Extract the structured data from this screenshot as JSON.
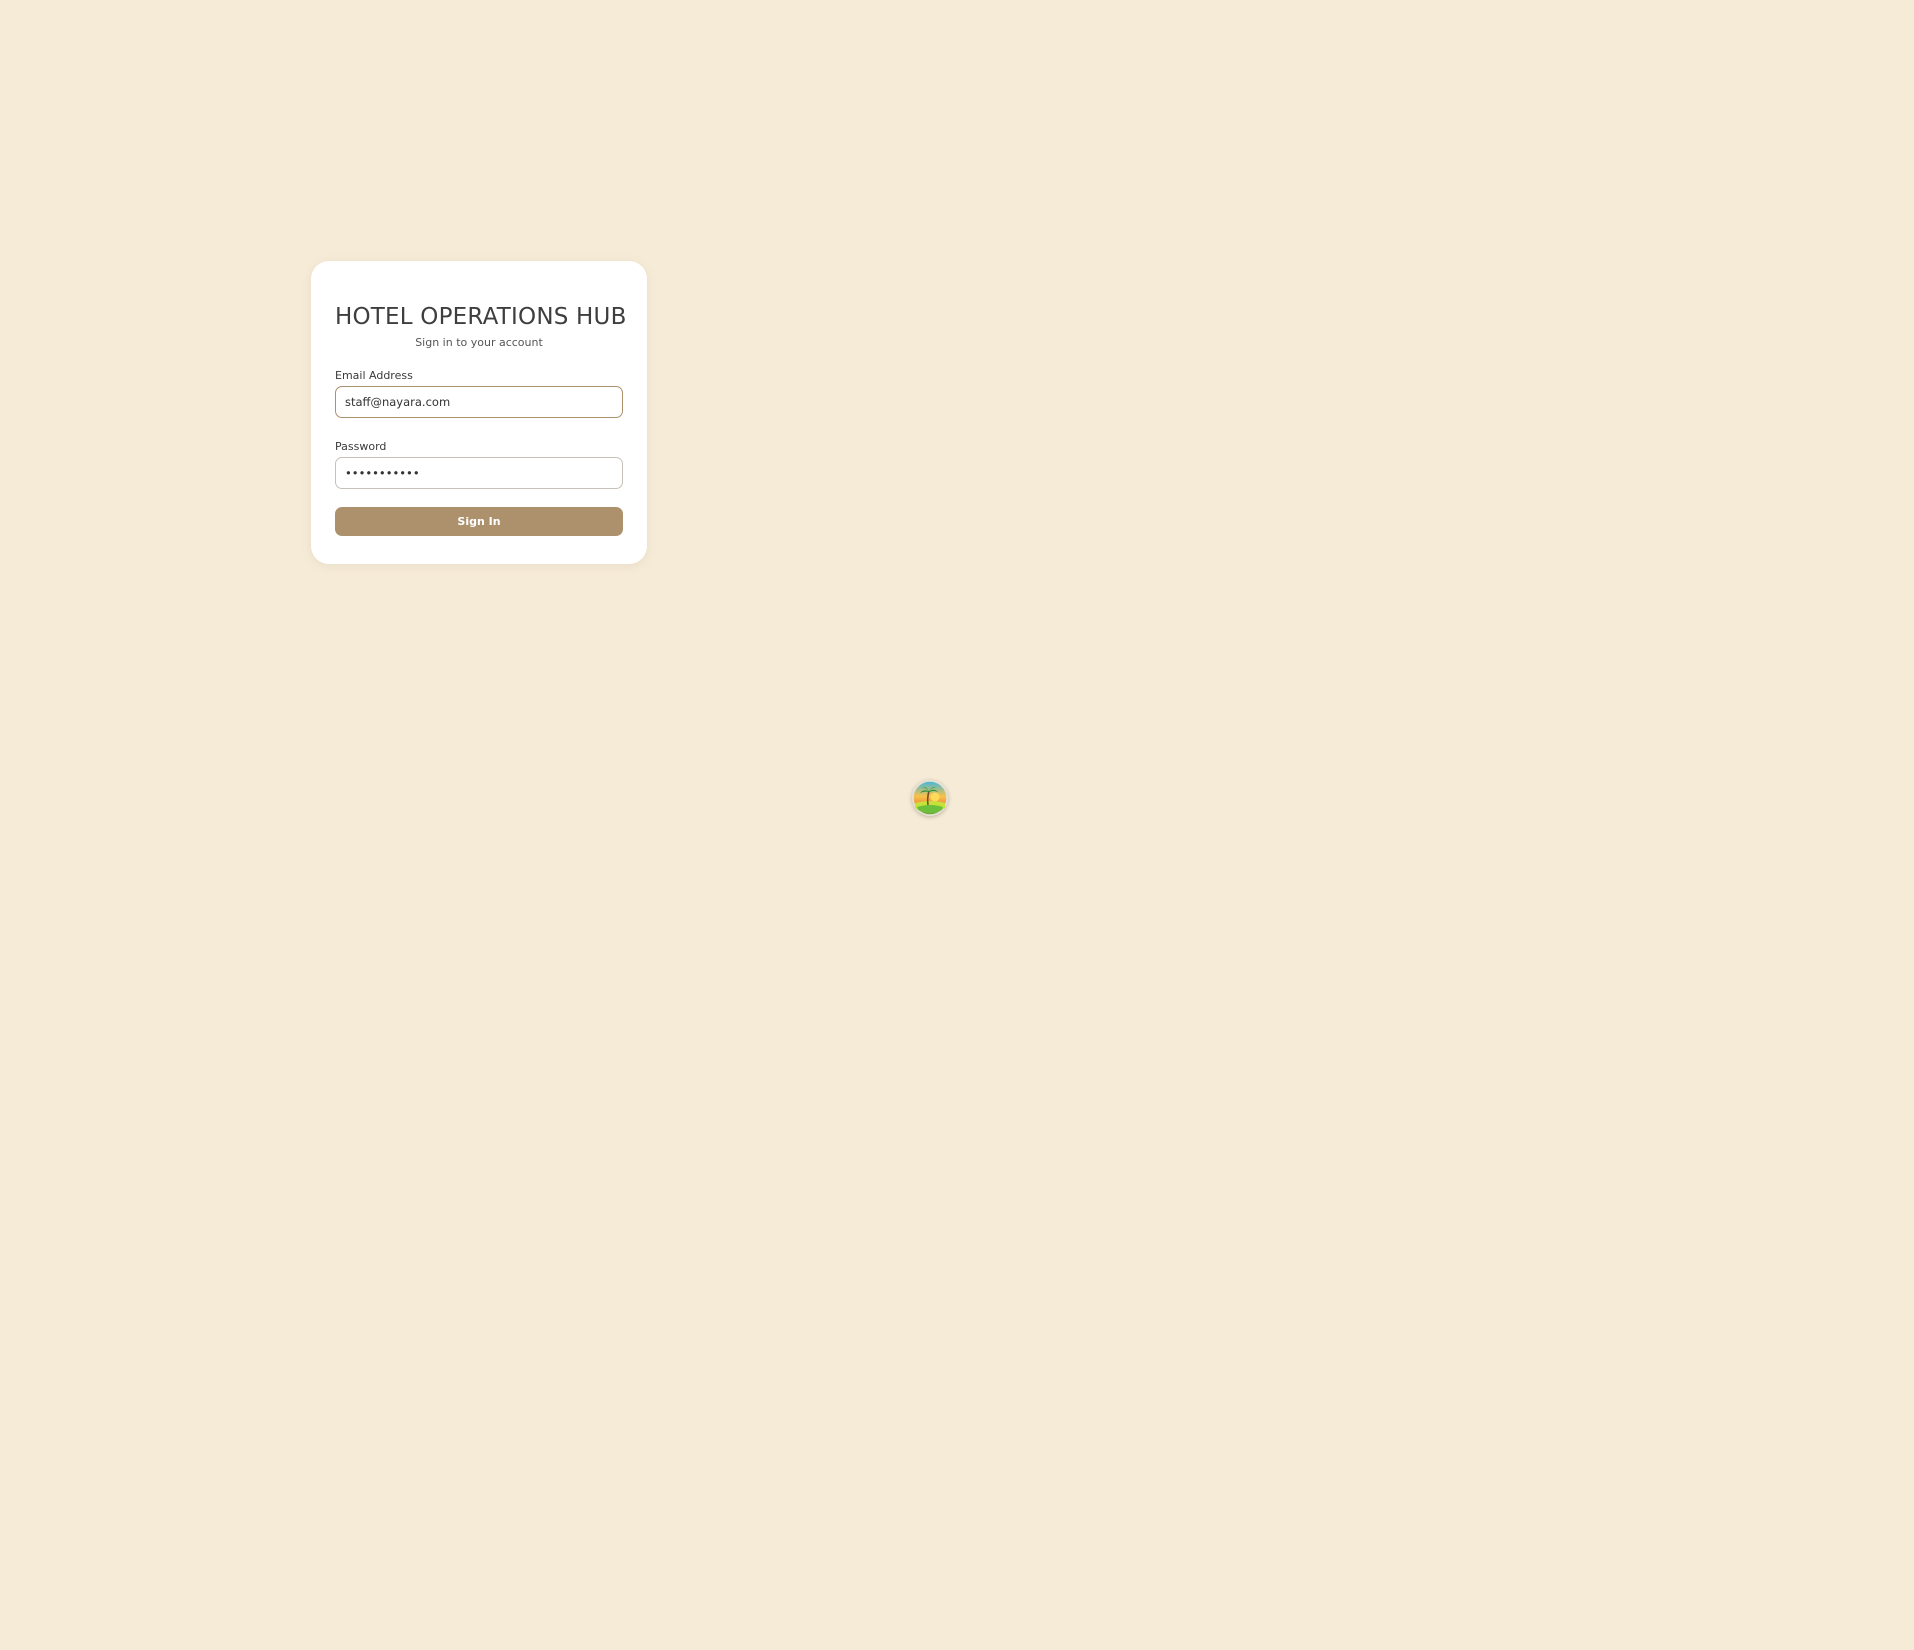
{
  "login": {
    "title": "HOTEL OPERATIONS HUB",
    "subtitle": "Sign in to your account",
    "email_label": "Email Address",
    "email_value": "staff@nayara.com",
    "password_label": "Password",
    "password_value": "•••••••••••",
    "submit_label": "Sign In"
  },
  "floating_badge": {
    "icon": "palm-beach-sunset-icon"
  },
  "colors": {
    "background": "#f5ebd7",
    "card": "#ffffff",
    "accent": "#ad916d",
    "text": "#3e3e3e"
  }
}
